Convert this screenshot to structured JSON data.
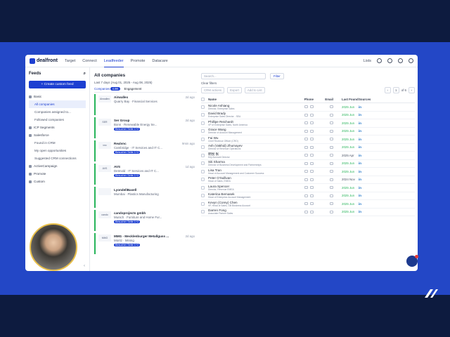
{
  "nav": {
    "brand": "dealfront",
    "tabs": [
      "Target",
      "Connect",
      "Leadfeeder",
      "Promote",
      "Datacare"
    ],
    "active_tab": "Leadfeeder",
    "lists_label": "Lists"
  },
  "sidebar": {
    "title": "Feeds",
    "create_button": "+ Create custom feed",
    "items": [
      {
        "label": "Basic",
        "sub": false,
        "active": false
      },
      {
        "label": "All companies",
        "sub": true,
        "active": true
      },
      {
        "label": "Companies assigned to...",
        "sub": true,
        "active": false
      },
      {
        "label": "Followed companies",
        "sub": true,
        "active": false
      },
      {
        "label": "ICP Segments",
        "sub": false,
        "active": false
      },
      {
        "label": "Salesforce",
        "sub": false,
        "active": false
      },
      {
        "label": "Found in CRM",
        "sub": true,
        "active": false
      },
      {
        "label": "My open opportunities",
        "sub": true,
        "active": false
      },
      {
        "label": "Suggested CRM connections",
        "sub": true,
        "active": false
      },
      {
        "label": "ActiveCampaign",
        "sub": false,
        "active": false
      },
      {
        "label": "Promote",
        "sub": false,
        "active": false
      },
      {
        "label": "Custom",
        "sub": false,
        "active": false
      }
    ]
  },
  "companies": {
    "title": "All companies",
    "date_filter": "Last 7 days (Aug 01, 2025 - Aug 08, 2025)",
    "tab_companies": "Companies",
    "tab_count": "4.8K",
    "tab_engagement": "Engagement",
    "cards": [
      {
        "name": "Airwallex",
        "logo": "Airwallex",
        "location": "Quarry Bay",
        "industry": "Financial Services",
        "date": "2d ago",
        "badge": ""
      },
      {
        "name": "Ser Group",
        "logo": "SER",
        "location": "Bonn",
        "industry": "Renewable Energy Se...",
        "date": "2d ago",
        "badge": "Besucher Seite 1+2"
      },
      {
        "name": "Realvnc",
        "logo": "vnc",
        "location": "Cambridge",
        "industry": "IT Services and IT C...",
        "date": "9min ago",
        "badge": "Besucher Seite 1+2"
      },
      {
        "name": "AVS",
        "logo": "AVS",
        "location": "Detmold",
        "industry": "IT Services and IT C...",
        "date": "1d ago",
        "badge": "Besucher Seite 1+2"
      },
      {
        "name": "LyondellBasell",
        "logo": "",
        "location": "Mumbai",
        "industry": "Plastics Manufacturing",
        "date": "",
        "badge": ""
      },
      {
        "name": "candoprojects gmbh",
        "logo": "cando",
        "location": "Munich",
        "industry": "Furniture and Home Fur...",
        "date": "",
        "badge": "Besucher Seite 1+2"
      },
      {
        "name": "MMG - Mecklenburger Metallguss ...",
        "logo": "MMG",
        "location": "Müritz",
        "industry": "Mining",
        "date": "2d ago",
        "badge": "Besucher Seite 1+2"
      }
    ]
  },
  "contacts": {
    "search_placeholder": "Search...",
    "filter_label": "Filter",
    "clear_filters": "Clear filters",
    "crm_actions": "CRM actions",
    "export": "Export",
    "add_to_list": "Add to List",
    "page": "1",
    "page_of": "of 6",
    "headers": {
      "name": "Name",
      "phone": "Phone",
      "email": "Email",
      "last_found": "Last Found",
      "sources": "Sources"
    },
    "rows": [
      {
        "name": "Nicole Ashiang",
        "title": "Director, Enterprise Sales",
        "last_found": "2025 Jun",
        "green": true
      },
      {
        "name": "David Brady",
        "title": "Enterprise Sales Director - SEA",
        "last_found": "2025 Jun",
        "green": true
      },
      {
        "name": "Phillipe Reichardt",
        "title": "VP of Enterprise Sales, North America",
        "last_found": "2025 Jun",
        "green": true
      },
      {
        "name": "Grace Wang",
        "title": "Director of Account Management",
        "last_found": "2025 Jun",
        "green": true
      },
      {
        "name": "Fai Wu",
        "title": "Chief Revenue Officer (CRO)",
        "last_found": "2025 Jun",
        "green": true
      },
      {
        "name": "Ash (Vakhid) Zhumayev",
        "title": "Director of Revenue Operations",
        "last_found": "2025 Jun",
        "green": true
      },
      {
        "name": "明悦 张",
        "title": "Key Account Director",
        "last_found": "2025 Apr",
        "green": false
      },
      {
        "name": "Siti Sharma",
        "title": "Director of Business Development and Partnerships",
        "last_found": "2025 Jun",
        "green": true
      },
      {
        "name": "Lisa Tran",
        "title": "Head of Account Management and Customer Success",
        "last_found": "2025 Jun",
        "green": true
      },
      {
        "name": "Peter O'Sullivan",
        "title": "Head of Sales, EMEA",
        "last_found": "2024 Nov",
        "green": false
      },
      {
        "name": "Laura Spencer",
        "title": "Director, Revenue EMEA",
        "last_found": "2025 Jun",
        "green": true
      },
      {
        "name": "Katerina Bemasek",
        "title": "Head of Enterprise Account Management",
        "last_found": "2025 Jun",
        "green": true
      },
      {
        "name": "Kevyn (Corey) Chen",
        "title": "VP, Head of Sales, GB Business Account",
        "last_found": "2025 Jun",
        "green": true
      },
      {
        "name": "Darren Fong",
        "title": "Associate Partner Sales",
        "last_found": "2025 Jun",
        "green": true
      }
    ]
  }
}
